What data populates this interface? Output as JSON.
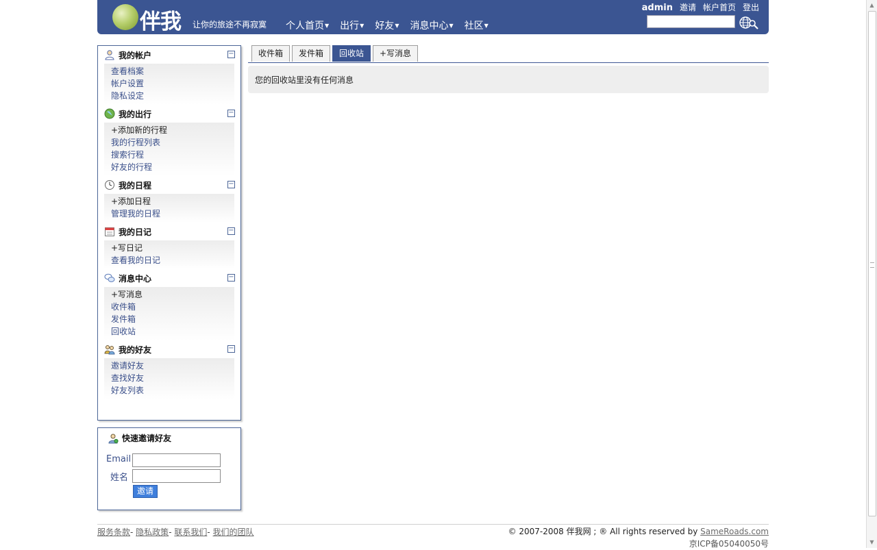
{
  "header": {
    "logo_text": "伴我",
    "slogan": "让你的旅途不再寂寞",
    "nav": [
      "个人首页",
      "出行",
      "好友",
      "消息中心",
      "社区"
    ],
    "username": "admin",
    "top_links": [
      "邀请",
      "帐户首页",
      "登出"
    ],
    "search_value": ""
  },
  "sidebar": {
    "sections": [
      {
        "title": "我的帐户",
        "icon": "user-icon",
        "links": [
          {
            "label": "查看档案"
          },
          {
            "label": "帐户设置"
          },
          {
            "label": "隐私设定"
          }
        ]
      },
      {
        "title": "我的出行",
        "icon": "globe-icon",
        "links": [
          {
            "label": "+添加新的行程"
          },
          {
            "label": "我的行程列表"
          },
          {
            "label": "搜索行程"
          },
          {
            "label": "好友的行程"
          }
        ]
      },
      {
        "title": "我的日程",
        "icon": "clock-icon",
        "links": [
          {
            "label": "+添加日程"
          },
          {
            "label": "管理我的日程"
          }
        ]
      },
      {
        "title": "我的日记",
        "icon": "calendar-icon",
        "links": [
          {
            "label": "+写日记"
          },
          {
            "label": "查看我的日记"
          }
        ]
      },
      {
        "title": "消息中心",
        "icon": "chat-icon",
        "links": [
          {
            "label": "+写消息"
          },
          {
            "label": "收件箱"
          },
          {
            "label": "发件箱"
          },
          {
            "label": "回收站"
          }
        ]
      },
      {
        "title": "我的好友",
        "icon": "friends-icon",
        "links": [
          {
            "label": "邀请好友"
          },
          {
            "label": "查找好友"
          },
          {
            "label": "好友列表"
          }
        ]
      }
    ],
    "collapse_symbol": "−"
  },
  "invite": {
    "title": "快速邀请好友",
    "email_label": "Email",
    "name_label": "姓名",
    "email_value": "",
    "name_value": "",
    "button_label": "邀请"
  },
  "tabs": [
    {
      "label": "收件箱",
      "active": false
    },
    {
      "label": "发件箱",
      "active": false
    },
    {
      "label": "回收站",
      "active": true
    },
    {
      "label": "+写消息",
      "active": false
    }
  ],
  "main": {
    "message": "您的回收站里没有任何消息"
  },
  "footer": {
    "links": [
      "服务条款",
      "隐私政策",
      "联系我们",
      "我们的团队"
    ],
    "copyright_prefix": "© 2007-2008 伴我网 ; ® All rights reserved by ",
    "copyright_link": "SameRoads.com",
    "icp": "京ICP备05040050号"
  },
  "colors": {
    "header_bg": "#3b5592",
    "active_tab": "#3b5592",
    "link": "#3a4f8a"
  }
}
